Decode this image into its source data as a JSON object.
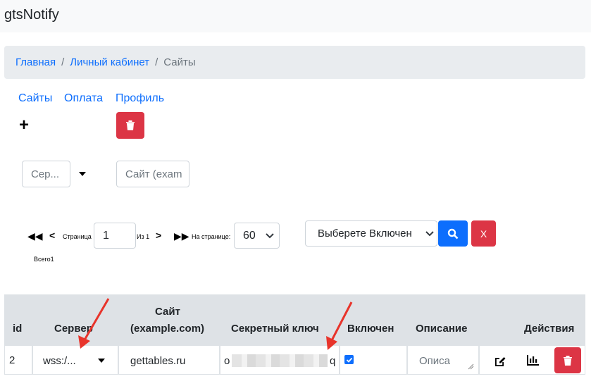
{
  "app": {
    "title": "gtsNotify"
  },
  "breadcrumb": {
    "home": "Главная",
    "account": "Личный кабинет",
    "current": "Сайты",
    "separator": "/"
  },
  "nav": {
    "sites": "Сайты",
    "payment": "Оплата",
    "profile": "Профиль"
  },
  "toolbar": {
    "add_symbol": "+"
  },
  "filters": {
    "server_placeholder": "Сер...",
    "site_placeholder": "Сайт (exam"
  },
  "pager": {
    "page_label": "Страница",
    "page_value": "1",
    "of_label": "Из 1",
    "per_page_label": "На странице:",
    "per_page_value": "60",
    "total_label": "Всего1"
  },
  "enabled_filter": {
    "value": "Выберете Включен"
  },
  "clear_button": {
    "label": "X"
  },
  "table": {
    "headers": {
      "id": "id",
      "server": "Сервер",
      "site_line1": "Сайт",
      "site_line2": "(example.com)",
      "secret": "Секретный ключ",
      "enabled": "Включен",
      "description": "Описание",
      "actions": "Действия"
    },
    "rows": [
      {
        "id": "2",
        "server": "wss:/...",
        "site": "gettables.ru",
        "secret_prefix": "o",
        "secret_suffix": "q",
        "enabled": true,
        "description_placeholder": "Описа"
      }
    ]
  },
  "colors": {
    "primary": "#0d6efd",
    "danger": "#dc3545",
    "header_bg": "#dee2e6",
    "arrow": "#e8342b"
  },
  "icons": [
    "plus-icon",
    "trash-icon",
    "chevron-down-icon",
    "first-page-icon",
    "prev-page-icon",
    "next-page-icon",
    "last-page-icon",
    "search-icon",
    "edit-icon",
    "chart-icon"
  ]
}
